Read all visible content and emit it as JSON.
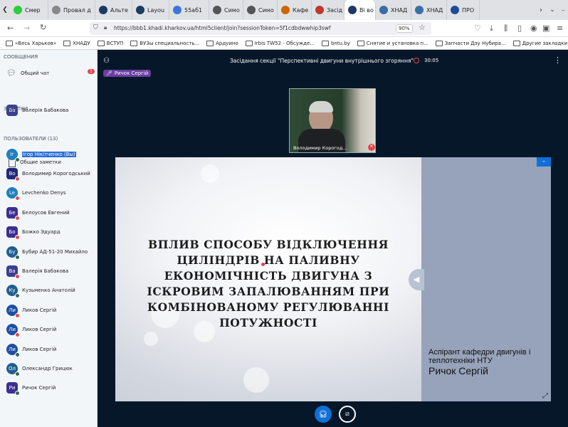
{
  "browser": {
    "tabs": [
      {
        "label": "Смер",
        "icon": "green-circle-icon",
        "color": "#2ecc40"
      },
      {
        "label": "Провал д",
        "icon": "page-icon",
        "color": "#888888"
      },
      {
        "label": "Альте",
        "icon": "bbb-icon",
        "color": "#1d3a63"
      },
      {
        "label": "Layou",
        "icon": "bbb-icon",
        "color": "#1d3a63"
      },
      {
        "label": "55аб1",
        "icon": "grid-icon",
        "color": "#3a78d8"
      },
      {
        "label": "Симо",
        "icon": "page-icon",
        "color": "#555555"
      },
      {
        "label": "Симо",
        "icon": "page-icon",
        "color": "#555555"
      },
      {
        "label": "Кафе",
        "icon": "page-icon",
        "color": "#cc6600"
      },
      {
        "label": "Засід",
        "icon": "m-icon",
        "color": "#c0392b"
      },
      {
        "label": "Ві во",
        "icon": "bbb-icon",
        "color": "#1d3a63"
      },
      {
        "label": "ХНАД",
        "icon": "globe-icon",
        "color": "#3a6ea5"
      },
      {
        "label": "ХНАД",
        "icon": "globe-icon",
        "color": "#3a6ea5"
      },
      {
        "label": "ПРО",
        "icon": "flag-icon",
        "color": "#1e4b9b"
      }
    ],
    "url": "https://bbb1.khadi.kharkov.ua/html5client/join?sessionToken=5f1cdbdwwhip3swf",
    "zoom": "90%",
    "bookmarks": [
      "«Весь Харьков»",
      "ХНАДУ",
      "ВСТУП",
      "ВУЗы специальность...",
      "Ардуино",
      "Irbis TW52 - Обсужде...",
      "bntu.by",
      "Снятие и установка п...",
      "Запчасти Дэу Нубира...",
      "Другие закладки"
    ]
  },
  "sidebar": {
    "messages_header": "СООБЩЕНИЯ",
    "public_chat": "Общий чат",
    "chat_badge": "1",
    "chat_user": {
      "initials": "Ва",
      "name": "Валерія Бабакова",
      "color": "#3a3f8f"
    },
    "notes_header": "ЗАМЕТКИ",
    "shared_notes": "Общие заметки",
    "users_header": "ПОЛЬЗОВАТЕЛИ (13)",
    "users": [
      {
        "initials": "Іг",
        "name": "Ігор Нікітченко (Вы)",
        "color": "#1f7fbf",
        "round": true,
        "mod": true,
        "selected": true
      },
      {
        "initials": "Во",
        "name": "Володимир Корогодський",
        "color": "#1e2a78",
        "round": false,
        "mod": false
      },
      {
        "initials": "Le",
        "name": "Levchenko Denys",
        "color": "#1f7fbf",
        "round": true,
        "mod": false
      },
      {
        "initials": "Бе",
        "name": "Белоусов Евгений",
        "color": "#3b2f8f",
        "round": false,
        "mod": false
      },
      {
        "initials": "Бо",
        "name": "Божко Эдуард",
        "color": "#3b2f8f",
        "round": false,
        "mod": false
      },
      {
        "initials": "Бу",
        "name": "Бубир АД-51-20 Михайло",
        "color": "#1f5f8f",
        "round": true,
        "mod": true
      },
      {
        "initials": "Ва",
        "name": "Валерія Бабакова",
        "color": "#3a3f8f",
        "round": false,
        "mod": false
      },
      {
        "initials": "Ку",
        "name": "Кузьменко Анатолій",
        "color": "#1f5f8f",
        "round": true,
        "mod": true
      },
      {
        "initials": "Ли",
        "name": "Ликов Сергій",
        "color": "#1e4fa0",
        "round": true,
        "mod": false
      },
      {
        "initials": "Ли",
        "name": "Ликов Сергій",
        "color": "#1e4fa0",
        "round": true,
        "mod": false
      },
      {
        "initials": "Ли",
        "name": "Ликов Сергій",
        "color": "#1e4fa0",
        "round": true,
        "mod": true
      },
      {
        "initials": "Ол",
        "name": "Олександр Грицюк",
        "color": "#1f5f8f",
        "round": true,
        "mod": true
      },
      {
        "initials": "Ри",
        "name": "Ричок Сергій",
        "color": "#3b2f8f",
        "round": false,
        "mod": true
      }
    ]
  },
  "meeting": {
    "title": "Засідання секції \"Перспективні двигуни внутрішнього згоряння\"",
    "timer": "30:05",
    "talker": "Ричок Сергій",
    "webcam_name": "Володимир Корогод..."
  },
  "slide": {
    "title_lines": [
      "ВПЛИВ СПОСОБУ ВІДКЛЮЧЕННЯ",
      "ЦИЛІНДРІВ НА ПАЛИВНУ",
      "ЕКОНОМІЧНІСТЬ ДВИГУНА З",
      "ІСКРОВИМ ЗАПАЛЮВАННЯМ ПРИ",
      "КОМБІНОВАНОМУ РЕГУЛЮВАННІ",
      "ПОТУЖНОСТІ"
    ],
    "author_line1": "Аспірант кафедри двигунів і",
    "author_line2": "теплотехніки НТУ",
    "author_name": "Ричок Сергій",
    "minimize_label": "–"
  },
  "colors": {
    "main_bg": "#06172a",
    "accent": "#0f70d7",
    "slide_panel": "#97a3ba"
  }
}
